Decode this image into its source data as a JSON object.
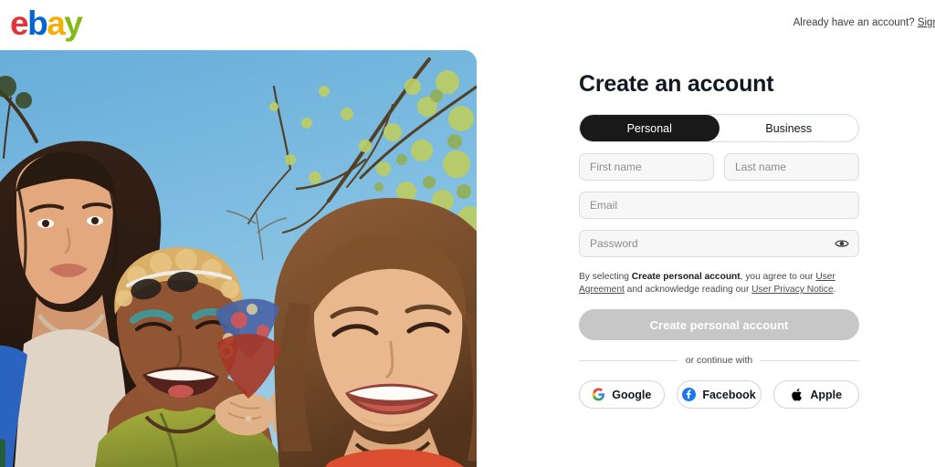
{
  "header": {
    "logo_text": "ebay",
    "logo_letters": [
      "e",
      "b",
      "a",
      "y"
    ],
    "logo_colors": [
      "#E53238",
      "#0064D2",
      "#F5AF02",
      "#86B817"
    ],
    "account_prompt": "Already have an account?",
    "signin_label": "Sign in"
  },
  "hero": {
    "alt": "Three smiling friends outdoors under a blue sky with blossoming trees",
    "sky_color": "#6FB7E4",
    "subjects": [
      {
        "name": "person-left",
        "shirt_color": "#1f5fc4"
      },
      {
        "name": "person-center",
        "shirt_color": "#8d9b2a"
      },
      {
        "name": "person-right",
        "shirt_color": "#d8492c"
      }
    ]
  },
  "form": {
    "title": "Create an account",
    "account_type": {
      "selected": "Personal",
      "options": [
        "Personal",
        "Business"
      ]
    },
    "fields": {
      "first_name": {
        "placeholder": "First name",
        "value": ""
      },
      "last_name": {
        "placeholder": "Last name",
        "value": ""
      },
      "email": {
        "placeholder": "Email",
        "value": ""
      },
      "password": {
        "placeholder": "Password",
        "value": ""
      }
    },
    "password_toggle_icon": "eye-icon",
    "legal": {
      "prefix": "By selecting ",
      "bold": "Create personal account",
      "middle": ", you agree to our ",
      "link1": "User Agreement",
      "middle2": " and acknowledge reading our ",
      "link2": "User Privacy Notice",
      "suffix": "."
    },
    "submit_label": "Create personal account",
    "submit_enabled": false,
    "submit_color": "#c7c7c7",
    "divider_text": "or continue with",
    "social": [
      {
        "label": "Google",
        "icon": "google-icon",
        "color": "#4285F4"
      },
      {
        "label": "Facebook",
        "icon": "facebook-icon",
        "color": "#1877F2"
      },
      {
        "label": "Apple",
        "icon": "apple-icon",
        "color": "#000000"
      }
    ]
  }
}
